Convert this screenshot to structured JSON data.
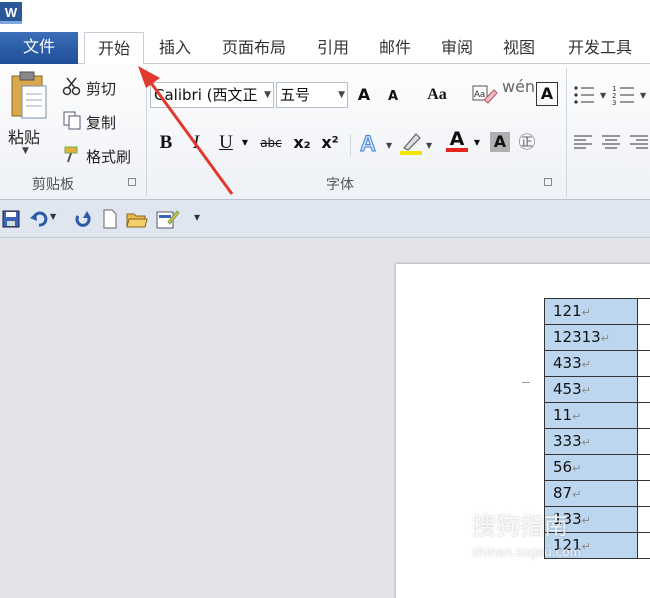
{
  "app": {
    "icon_letter": "W"
  },
  "tabs": [
    "文件",
    "开始",
    "插入",
    "页面布局",
    "引用",
    "邮件",
    "审阅",
    "视图",
    "开发工具"
  ],
  "ribbon": {
    "clipboard": {
      "paste": "粘贴",
      "cut": "剪切",
      "copy": "复制",
      "format_painter": "格式刷",
      "label": "剪贴板"
    },
    "font": {
      "font_name": "Calibri (西文正",
      "font_size": "五号",
      "grow": "A",
      "shrink": "A",
      "change_case": "Aa",
      "bold": "B",
      "italic": "I",
      "underline": "U",
      "strikethrough": "abc",
      "subscript": "x₂",
      "superscript": "x²",
      "font_color": "A",
      "char_shading": "A",
      "enclose": "㊣",
      "phonetic": "wén",
      "border": "A",
      "label": "字体"
    }
  },
  "table": {
    "values": [
      "121",
      "12313",
      "433",
      "453",
      "11",
      "333",
      "56",
      "87",
      "133",
      "121"
    ]
  },
  "watermark": {
    "text": "搜狗指南",
    "sub": "zhinan.sogou.com"
  },
  "colors": {
    "file_tab": "#2b5fa8",
    "cell_fill": "#bcd6f0",
    "arrow": "#e03a2f"
  }
}
